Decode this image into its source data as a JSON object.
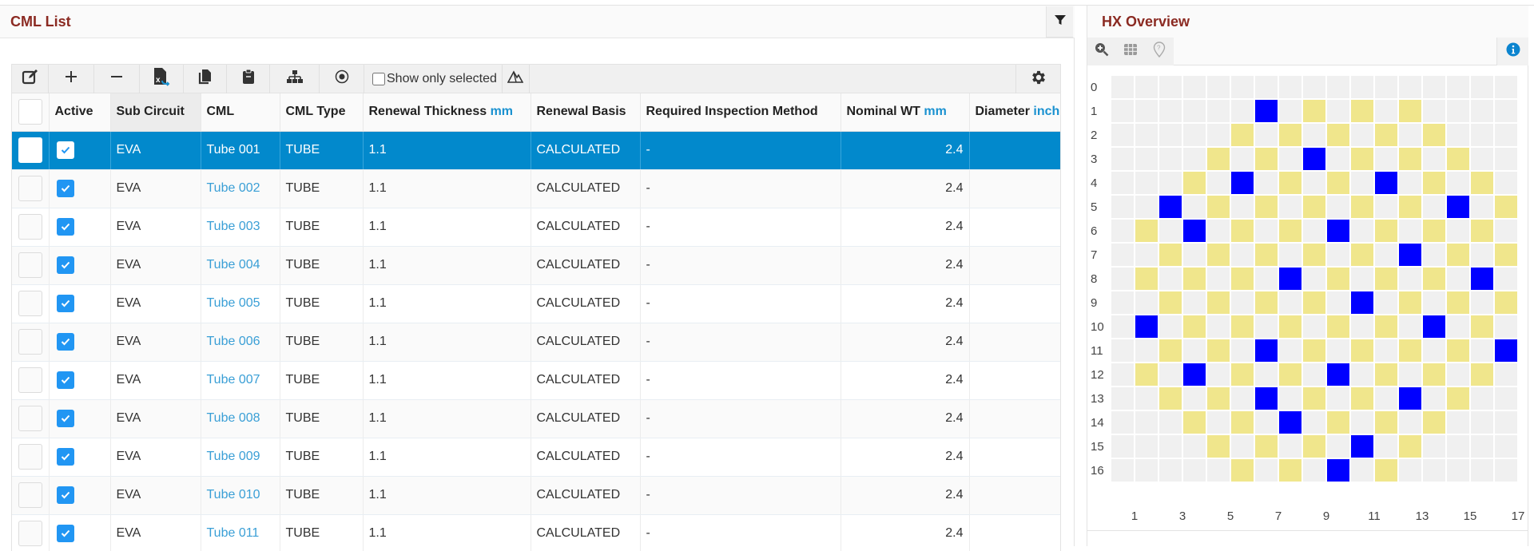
{
  "left_panel": {
    "title": "CML List",
    "filter_icon": "filter-icon",
    "toolbar": {
      "buttons": [
        {
          "name": "edit",
          "icon": "edit-icon"
        },
        {
          "name": "add",
          "icon": "plus-icon"
        },
        {
          "name": "remove",
          "icon": "minus-icon"
        },
        {
          "name": "export-excel",
          "icon": "excel-export-icon"
        },
        {
          "name": "copy",
          "icon": "copy-icon"
        },
        {
          "name": "paste",
          "icon": "clipboard-icon"
        },
        {
          "name": "hierarchy",
          "icon": "sitemap-icon"
        },
        {
          "name": "target",
          "icon": "dot-circle-icon"
        }
      ],
      "show_only_selected_label": "Show only selected",
      "show_only_selected_checked": false,
      "mountain_icon": "mountain-icon",
      "settings_icon": "gear-icon"
    },
    "columns": [
      {
        "label": "",
        "unit": ""
      },
      {
        "label": "Active",
        "unit": ""
      },
      {
        "label": "Sub Circuit",
        "unit": ""
      },
      {
        "label": "CML",
        "unit": ""
      },
      {
        "label": "CML Type",
        "unit": ""
      },
      {
        "label": "Renewal Thickness ",
        "unit": "mm"
      },
      {
        "label": "Renewal Basis",
        "unit": ""
      },
      {
        "label": "Required Inspection Method",
        "unit": ""
      },
      {
        "label": "Nominal WT ",
        "unit": "mm"
      },
      {
        "label": "Diameter ",
        "unit": "inch"
      }
    ],
    "rows": [
      {
        "active": true,
        "sub_circuit": "EVA",
        "cml": "Tube 001",
        "cml_type": "TUBE",
        "renewal_thickness": "1.1",
        "renewal_basis": "CALCULATED",
        "inspection_method": "-",
        "nominal_wt": "2.4",
        "diameter": "",
        "selected": true
      },
      {
        "active": true,
        "sub_circuit": "EVA",
        "cml": "Tube 002",
        "cml_type": "TUBE",
        "renewal_thickness": "1.1",
        "renewal_basis": "CALCULATED",
        "inspection_method": "-",
        "nominal_wt": "2.4",
        "diameter": "",
        "selected": false
      },
      {
        "active": true,
        "sub_circuit": "EVA",
        "cml": "Tube 003",
        "cml_type": "TUBE",
        "renewal_thickness": "1.1",
        "renewal_basis": "CALCULATED",
        "inspection_method": "-",
        "nominal_wt": "2.4",
        "diameter": "",
        "selected": false
      },
      {
        "active": true,
        "sub_circuit": "EVA",
        "cml": "Tube 004",
        "cml_type": "TUBE",
        "renewal_thickness": "1.1",
        "renewal_basis": "CALCULATED",
        "inspection_method": "-",
        "nominal_wt": "2.4",
        "diameter": "",
        "selected": false
      },
      {
        "active": true,
        "sub_circuit": "EVA",
        "cml": "Tube 005",
        "cml_type": "TUBE",
        "renewal_thickness": "1.1",
        "renewal_basis": "CALCULATED",
        "inspection_method": "-",
        "nominal_wt": "2.4",
        "diameter": "",
        "selected": false
      },
      {
        "active": true,
        "sub_circuit": "EVA",
        "cml": "Tube 006",
        "cml_type": "TUBE",
        "renewal_thickness": "1.1",
        "renewal_basis": "CALCULATED",
        "inspection_method": "-",
        "nominal_wt": "2.4",
        "diameter": "",
        "selected": false
      },
      {
        "active": true,
        "sub_circuit": "EVA",
        "cml": "Tube 007",
        "cml_type": "TUBE",
        "renewal_thickness": "1.1",
        "renewal_basis": "CALCULATED",
        "inspection_method": "-",
        "nominal_wt": "2.4",
        "diameter": "",
        "selected": false
      },
      {
        "active": true,
        "sub_circuit": "EVA",
        "cml": "Tube 008",
        "cml_type": "TUBE",
        "renewal_thickness": "1.1",
        "renewal_basis": "CALCULATED",
        "inspection_method": "-",
        "nominal_wt": "2.4",
        "diameter": "",
        "selected": false
      },
      {
        "active": true,
        "sub_circuit": "EVA",
        "cml": "Tube 009",
        "cml_type": "TUBE",
        "renewal_thickness": "1.1",
        "renewal_basis": "CALCULATED",
        "inspection_method": "-",
        "nominal_wt": "2.4",
        "diameter": "",
        "selected": false
      },
      {
        "active": true,
        "sub_circuit": "EVA",
        "cml": "Tube 010",
        "cml_type": "TUBE",
        "renewal_thickness": "1.1",
        "renewal_basis": "CALCULATED",
        "inspection_method": "-",
        "nominal_wt": "2.4",
        "diameter": "",
        "selected": false
      },
      {
        "active": true,
        "sub_circuit": "EVA",
        "cml": "Tube 011",
        "cml_type": "TUBE",
        "renewal_thickness": "1.1",
        "renewal_basis": "CALCULATED",
        "inspection_method": "-",
        "nominal_wt": "2.4",
        "diameter": "",
        "selected": false
      }
    ]
  },
  "right_panel": {
    "title": "HX Overview",
    "toolbar_icons": [
      "zoom-in-icon",
      "grid-icon",
      "map-marker-question-icon"
    ],
    "info_icon": "info-icon",
    "colors": {
      "empty": "#f0f0f0",
      "yellow": "#f0e68c",
      "blue": "#0000ff"
    },
    "row_labels": [
      "0",
      "1",
      "2",
      "3",
      "4",
      "5",
      "6",
      "7",
      "8",
      "9",
      "10",
      "11",
      "12",
      "13",
      "14",
      "15",
      "16"
    ],
    "col_labels": [
      "1",
      "3",
      "5",
      "7",
      "9",
      "11",
      "13",
      "15",
      "17"
    ],
    "num_cols": 17,
    "tube_map": [
      {
        "row": 0,
        "yellow": [],
        "blue": []
      },
      {
        "row": 1,
        "yellow": [
          9,
          11,
          13
        ],
        "blue": [
          7
        ]
      },
      {
        "row": 2,
        "yellow": [
          6,
          8,
          10,
          12,
          14
        ],
        "blue": []
      },
      {
        "row": 3,
        "yellow": [
          5,
          7,
          11,
          13,
          15
        ],
        "blue": [
          9
        ]
      },
      {
        "row": 4,
        "yellow": [
          4,
          8,
          10,
          14,
          16
        ],
        "blue": [
          6,
          12
        ]
      },
      {
        "row": 5,
        "yellow": [
          5,
          7,
          9,
          11,
          13,
          17
        ],
        "blue": [
          3,
          15
        ]
      },
      {
        "row": 6,
        "yellow": [
          2,
          6,
          8,
          12,
          14,
          16
        ],
        "blue": [
          4,
          10
        ]
      },
      {
        "row": 7,
        "yellow": [
          3,
          5,
          7,
          9,
          11,
          15,
          17
        ],
        "blue": [
          13
        ]
      },
      {
        "row": 8,
        "yellow": [
          2,
          4,
          6,
          10,
          12,
          14
        ],
        "blue": [
          8,
          16
        ]
      },
      {
        "row": 9,
        "yellow": [
          3,
          5,
          7,
          9,
          13,
          15,
          17
        ],
        "blue": [
          11
        ]
      },
      {
        "row": 10,
        "yellow": [
          4,
          6,
          8,
          10,
          12,
          16
        ],
        "blue": [
          2,
          14
        ]
      },
      {
        "row": 11,
        "yellow": [
          3,
          5,
          9,
          11,
          13,
          15
        ],
        "blue": [
          7,
          17
        ]
      },
      {
        "row": 12,
        "yellow": [
          2,
          6,
          8,
          12,
          14,
          16
        ],
        "blue": [
          4,
          10
        ]
      },
      {
        "row": 13,
        "yellow": [
          3,
          5,
          9,
          11,
          15
        ],
        "blue": [
          7,
          13
        ]
      },
      {
        "row": 14,
        "yellow": [
          4,
          6,
          10,
          12,
          14
        ],
        "blue": [
          8
        ]
      },
      {
        "row": 15,
        "yellow": [
          5,
          7,
          9,
          13
        ],
        "blue": [
          11
        ]
      },
      {
        "row": 16,
        "yellow": [
          6,
          8,
          12
        ],
        "blue": [
          10
        ]
      }
    ]
  }
}
